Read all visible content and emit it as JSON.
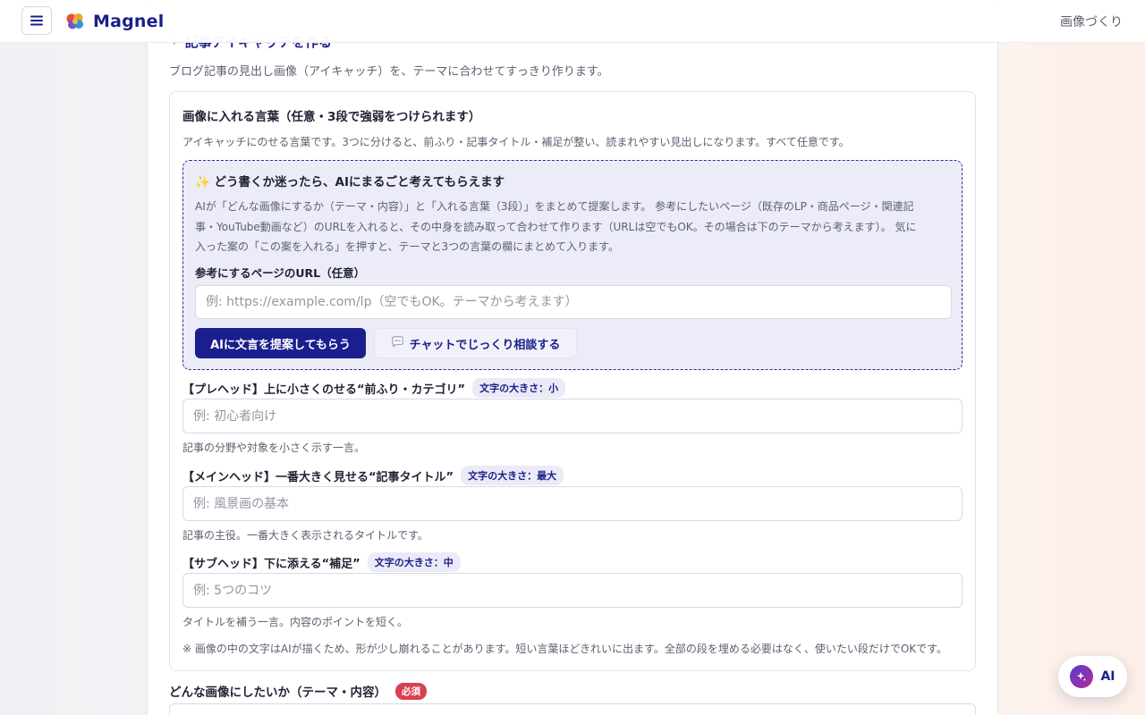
{
  "header": {
    "brand": "Magnel",
    "right_link": "画像づくり"
  },
  "section": {
    "title": "記事アイキャッチを作る",
    "description": "ブログ記事の見出し画像（アイキャッチ）を、テーマに合わせてすっきり作ります。"
  },
  "text_panel": {
    "title": "画像に入れる言葉（任意・3段で強弱をつけられます）",
    "description": "アイキャッチにのせる言葉です。3つに分けると、前ふり・記事タイトル・補足が整い、読まれやすい見出しになります。すべて任意です。",
    "ai_box": {
      "title": "✨ どう書くか迷ったら、AIにまるごと考えてもらえます",
      "description_line1": "AIが「どんな画像にするか（テーマ・内容）」と「入れる言葉（3段）」をまとめて提案します。 参考にしたいページ（既存のLP・商品ページ・関連記",
      "description_line2": "事・YouTube動画など）のURLを入れると、その中身を読み取って合わせて作ります（URLは空でもOK。その場合は下のテーマから考えます）。 気に",
      "description_line3": "入った案の「この案を入れる」を押すと、テーマと3つの言葉の欄にまとめて入ります。",
      "url_label": "参考にするページのURL（任意）",
      "url_placeholder": "例: https://example.com/lp（空でもOK。テーマから考えます）",
      "suggest_button": "AIに文言を提案してもらう",
      "chat_button": "チャットでじっくり相談する"
    },
    "prehead": {
      "label": "【プレヘッド】上に小さくのせる“前ふり・カテゴリ”",
      "badge": "文字の大きさ：小",
      "placeholder": "例: 初心者向け",
      "help": "記事の分野や対象を小さく示す一言。"
    },
    "mainhead": {
      "label": "【メインヘッド】一番大きく見せる“記事タイトル”",
      "badge": "文字の大きさ：最大",
      "placeholder": "例: 風景画の基本",
      "help": "記事の主役。一番大きく表示されるタイトルです。"
    },
    "subhead": {
      "label": "【サブヘッド】下に添える“補足”",
      "badge": "文字の大きさ：中",
      "placeholder": "例: 5つのコツ",
      "help": "タイトルを補う一言。内容のポイントを短く。"
    },
    "note": "※ 画像の中の文字はAIが描くため、形が少し崩れることがあります。短い言葉ほどきれいに出ます。全部の段を埋める必要はなく、使いたい段だけでOKです。"
  },
  "theme": {
    "label": "どんな画像にしたいか（テーマ・内容）",
    "required": "必須"
  },
  "fab": {
    "label": "AI"
  },
  "colors": {
    "brand": "#1a1f8a",
    "primary_button": "#1b1e8e",
    "required": "#d8414f"
  }
}
